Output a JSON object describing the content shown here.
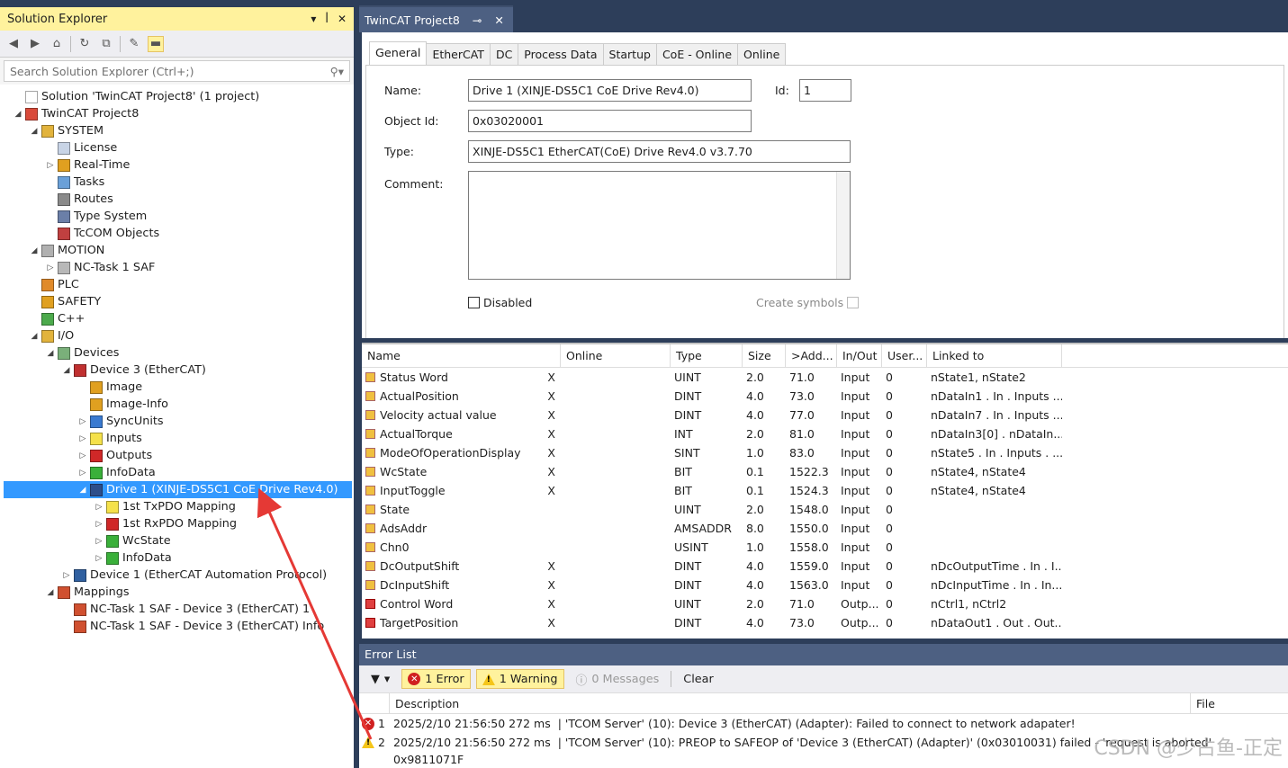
{
  "solution_explorer": {
    "title": "Solution Explorer",
    "title_controls": [
      "▾",
      "ꟾ",
      "✕"
    ],
    "search_placeholder": "Search Solution Explorer (Ctrl+;)",
    "tree": [
      {
        "label": "Solution 'TwinCAT Project8' (1 project)",
        "depth": 0,
        "arrow": "",
        "icon": "solution-icon",
        "color": "#ffffff"
      },
      {
        "label": "TwinCAT Project8",
        "depth": 0,
        "arrow": "◢",
        "icon": "project-icon",
        "color": "#d94a3a"
      },
      {
        "label": "SYSTEM",
        "depth": 1,
        "arrow": "◢",
        "icon": "system-icon",
        "color": "#e2b33c"
      },
      {
        "label": "License",
        "depth": 2,
        "arrow": "",
        "icon": "license-icon",
        "color": "#c8d4e6"
      },
      {
        "label": "Real-Time",
        "depth": 2,
        "arrow": "▷",
        "icon": "realtime-icon",
        "color": "#e0a020"
      },
      {
        "label": "Tasks",
        "depth": 2,
        "arrow": "",
        "icon": "tasks-icon",
        "color": "#6aa0d8"
      },
      {
        "label": "Routes",
        "depth": 2,
        "arrow": "",
        "icon": "routes-icon",
        "color": "#8a8a8a"
      },
      {
        "label": "Type System",
        "depth": 2,
        "arrow": "",
        "icon": "type-system-icon",
        "color": "#6b7fa8"
      },
      {
        "label": "TcCOM Objects",
        "depth": 2,
        "arrow": "",
        "icon": "tccom-icon",
        "color": "#c04040"
      },
      {
        "label": "MOTION",
        "depth": 1,
        "arrow": "◢",
        "icon": "motion-icon",
        "color": "#b0b0b0"
      },
      {
        "label": "NC-Task 1 SAF",
        "depth": 2,
        "arrow": "▷",
        "icon": "nc-task-icon",
        "color": "#b8b8b8"
      },
      {
        "label": "PLC",
        "depth": 1,
        "arrow": "",
        "icon": "plc-icon",
        "color": "#e08a2a"
      },
      {
        "label": "SAFETY",
        "depth": 1,
        "arrow": "",
        "icon": "safety-icon",
        "color": "#e0a020"
      },
      {
        "label": "C++",
        "depth": 1,
        "arrow": "",
        "icon": "cpp-icon",
        "color": "#4caa4c"
      },
      {
        "label": "I/O",
        "depth": 1,
        "arrow": "◢",
        "icon": "io-icon",
        "color": "#e2b33c"
      },
      {
        "label": "Devices",
        "depth": 2,
        "arrow": "◢",
        "icon": "devices-icon",
        "color": "#7ab07a"
      },
      {
        "label": "Device 3 (EtherCAT)",
        "depth": 3,
        "arrow": "◢",
        "icon": "ethercat-device-icon",
        "color": "#c03030"
      },
      {
        "label": "Image",
        "depth": 4,
        "arrow": "",
        "icon": "image-icon",
        "color": "#e0a020"
      },
      {
        "label": "Image-Info",
        "depth": 4,
        "arrow": "",
        "icon": "image-info-icon",
        "color": "#e0a020"
      },
      {
        "label": "SyncUnits",
        "depth": 4,
        "arrow": "▷",
        "icon": "syncunits-icon",
        "color": "#3a7ad0"
      },
      {
        "label": "Inputs",
        "depth": 4,
        "arrow": "▷",
        "icon": "inputs-icon",
        "color": "#f5e14a"
      },
      {
        "label": "Outputs",
        "depth": 4,
        "arrow": "▷",
        "icon": "outputs-icon",
        "color": "#d02828"
      },
      {
        "label": "InfoData",
        "depth": 4,
        "arrow": "▷",
        "icon": "infodata-icon",
        "color": "#3ab03a"
      },
      {
        "label": "Drive 1 (XINJE-DS5C1 CoE Drive Rev4.0)",
        "depth": 4,
        "arrow": "◢",
        "icon": "drive-icon",
        "color": "#2d4e8a",
        "selected": true
      },
      {
        "label": "1st TxPDO Mapping",
        "depth": 5,
        "arrow": "▷",
        "icon": "txpdo-icon",
        "color": "#f5e14a"
      },
      {
        "label": "1st RxPDO Mapping",
        "depth": 5,
        "arrow": "▷",
        "icon": "rxpdo-icon",
        "color": "#d02828"
      },
      {
        "label": "WcState",
        "depth": 5,
        "arrow": "▷",
        "icon": "wcstate-icon",
        "color": "#3ab03a"
      },
      {
        "label": "InfoData",
        "depth": 5,
        "arrow": "▷",
        "icon": "infodata-icon",
        "color": "#3ab03a"
      },
      {
        "label": "Device 1 (EtherCAT Automation Protocol)",
        "depth": 3,
        "arrow": "▷",
        "icon": "eap-device-icon",
        "color": "#3060a0"
      },
      {
        "label": "Mappings",
        "depth": 2,
        "arrow": "◢",
        "icon": "mappings-icon",
        "color": "#d05030"
      },
      {
        "label": "NC-Task 1 SAF - Device 3 (EtherCAT) 1",
        "depth": 3,
        "arrow": "",
        "icon": "mapping-icon",
        "color": "#d05030"
      },
      {
        "label": "NC-Task 1 SAF - Device 3 (EtherCAT) Info",
        "depth": 3,
        "arrow": "",
        "icon": "mapping-icon",
        "color": "#d05030"
      }
    ]
  },
  "document": {
    "tab_title": "TwinCAT Project8",
    "tabs": [
      "General",
      "EtherCAT",
      "DC",
      "Process Data",
      "Startup",
      "CoE - Online",
      "Online"
    ],
    "active_tab": "General",
    "fields": {
      "name_label": "Name:",
      "name_value": "Drive 1 (XINJE-DS5C1 CoE Drive Rev4.0)",
      "id_label": "Id:",
      "id_value": "1",
      "objectid_label": "Object Id:",
      "objectid_value": "0x03020001",
      "type_label": "Type:",
      "type_value": "XINJE-DS5C1 EtherCAT(CoE) Drive Rev4.0 v3.7.70",
      "comment_label": "Comment:",
      "comment_value": "",
      "disabled_label": "Disabled",
      "create_symbols_label": "Create symbols"
    }
  },
  "variables": {
    "columns": [
      "Name",
      "Online",
      "Type",
      "Size",
      ">Add...",
      "In/Out",
      "User...",
      "Linked to"
    ],
    "rows": [
      {
        "name": "Status Word",
        "x": "X",
        "online": "",
        "type": "UINT",
        "size": "2.0",
        "addr": "71.0",
        "io": "Input",
        "user": "0",
        "linked": "nState1, nState2",
        "dir": "in"
      },
      {
        "name": "ActualPosition",
        "x": "X",
        "online": "",
        "type": "DINT",
        "size": "4.0",
        "addr": "73.0",
        "io": "Input",
        "user": "0",
        "linked": "nDataIn1 . In . Inputs ....",
        "dir": "in"
      },
      {
        "name": "Velocity actual value",
        "x": "X",
        "online": "",
        "type": "DINT",
        "size": "4.0",
        "addr": "77.0",
        "io": "Input",
        "user": "0",
        "linked": "nDataIn7 . In . Inputs ....",
        "dir": "in"
      },
      {
        "name": "ActualTorque",
        "x": "X",
        "online": "",
        "type": "INT",
        "size": "2.0",
        "addr": "81.0",
        "io": "Input",
        "user": "0",
        "linked": "nDataIn3[0] . nDataIn...",
        "dir": "in"
      },
      {
        "name": "ModeOfOperationDisplay",
        "x": "X",
        "online": "",
        "type": "SINT",
        "size": "1.0",
        "addr": "83.0",
        "io": "Input",
        "user": "0",
        "linked": "nState5 . In . Inputs . ...",
        "dir": "in"
      },
      {
        "name": "WcState",
        "x": "X",
        "online": "",
        "type": "BIT",
        "size": "0.1",
        "addr": "1522.3",
        "io": "Input",
        "user": "0",
        "linked": "nState4, nState4",
        "dir": "in"
      },
      {
        "name": "InputToggle",
        "x": "X",
        "online": "",
        "type": "BIT",
        "size": "0.1",
        "addr": "1524.3",
        "io": "Input",
        "user": "0",
        "linked": "nState4, nState4",
        "dir": "in"
      },
      {
        "name": "State",
        "x": "",
        "online": "",
        "type": "UINT",
        "size": "2.0",
        "addr": "1548.0",
        "io": "Input",
        "user": "0",
        "linked": "",
        "dir": "in"
      },
      {
        "name": "AdsAddr",
        "x": "",
        "online": "",
        "type": "AMSADDR",
        "size": "8.0",
        "addr": "1550.0",
        "io": "Input",
        "user": "0",
        "linked": "",
        "dir": "in"
      },
      {
        "name": "Chn0",
        "x": "",
        "online": "",
        "type": "USINT",
        "size": "1.0",
        "addr": "1558.0",
        "io": "Input",
        "user": "0",
        "linked": "",
        "dir": "in"
      },
      {
        "name": "DcOutputShift",
        "x": "X",
        "online": "",
        "type": "DINT",
        "size": "4.0",
        "addr": "1559.0",
        "io": "Input",
        "user": "0",
        "linked": "nDcOutputTime . In . I...",
        "dir": "in"
      },
      {
        "name": "DcInputShift",
        "x": "X",
        "online": "",
        "type": "DINT",
        "size": "4.0",
        "addr": "1563.0",
        "io": "Input",
        "user": "0",
        "linked": "nDcInputTime . In . In...",
        "dir": "in"
      },
      {
        "name": "Control Word",
        "x": "X",
        "online": "",
        "type": "UINT",
        "size": "2.0",
        "addr": "71.0",
        "io": "Outp...",
        "user": "0",
        "linked": "nCtrl1, nCtrl2",
        "dir": "out"
      },
      {
        "name": "TargetPosition",
        "x": "X",
        "online": "",
        "type": "DINT",
        "size": "4.0",
        "addr": "73.0",
        "io": "Outp...",
        "user": "0",
        "linked": "nDataOut1 . Out . Out...",
        "dir": "out"
      }
    ]
  },
  "error_list": {
    "title": "Error List",
    "filter_label": "▼",
    "error_count_label": "1 Error",
    "warning_count_label": "1 Warning",
    "messages_count_label": "0 Messages",
    "clear_label": "Clear",
    "columns": [
      "Description",
      "File"
    ],
    "rows": [
      {
        "kind": "error",
        "num": "1",
        "time": "2025/2/10 21:56:50 272 ms",
        "text": "| 'TCOM Server' (10): Device 3 (EtherCAT) (Adapter): Failed to connect to network adapater!"
      },
      {
        "kind": "warning",
        "num": "2",
        "time": "2025/2/10 21:56:50 272 ms",
        "text": "| 'TCOM Server' (10): PREOP to SAFEOP of 'Device 3 (EtherCAT) (Adapter)' (0x03010031) failed - 'request is aborted'",
        "continuation": "0x9811071F"
      }
    ]
  },
  "watermark": "CSDN @少占鱼-正定",
  "colors": {
    "accent_yellow": "#fff29d",
    "selection_blue": "#3399ff",
    "frame_navy": "#2d3e5a",
    "annotation_red": "#e53935"
  }
}
